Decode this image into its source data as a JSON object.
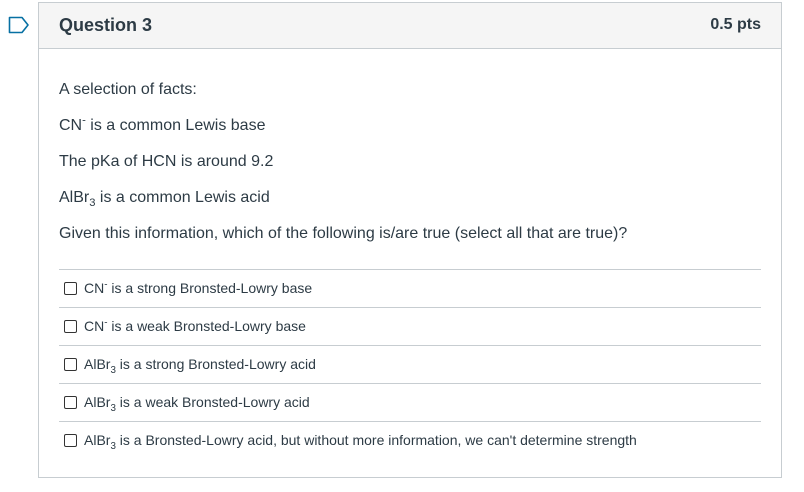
{
  "question": {
    "title": "Question 3",
    "points": "0.5 pts"
  },
  "body": {
    "intro": "A selection of facts:",
    "facts": [
      {
        "main": "CN",
        "sup": "-",
        "rest": " is a common Lewis base"
      },
      {
        "text": "The pKa of HCN is around 9.2"
      },
      {
        "main": "AlBr",
        "sub": "3",
        "rest": " is a common Lewis acid"
      }
    ],
    "prompt": "Given this information, which of the following is/are true (select all that are true)?"
  },
  "answers": [
    {
      "main": "CN",
      "sup": "-",
      "sub": "",
      "rest": " is a strong Bronsted-Lowry base",
      "checked": false
    },
    {
      "main": "CN",
      "sup": "-",
      "sub": "",
      "rest": " is a weak Bronsted-Lowry base",
      "checked": false
    },
    {
      "main": "AlBr",
      "sup": "",
      "sub": "3",
      "rest": " is a strong Bronsted-Lowry acid",
      "checked": false
    },
    {
      "main": "AlBr",
      "sup": "",
      "sub": "3",
      "rest": " is a weak Bronsted-Lowry acid",
      "checked": false
    },
    {
      "main": "AlBr",
      "sup": "",
      "sub": "3",
      "rest": " is a Bronsted-Lowry acid, but without more information, we can't determine strength",
      "checked": false
    }
  ],
  "colors": {
    "text": "#2d3b45",
    "border": "#c7cdd1",
    "header_bg": "#f5f5f5",
    "flag": "#0770a3"
  },
  "icons": {
    "flag": "bookmark-flag-icon"
  }
}
